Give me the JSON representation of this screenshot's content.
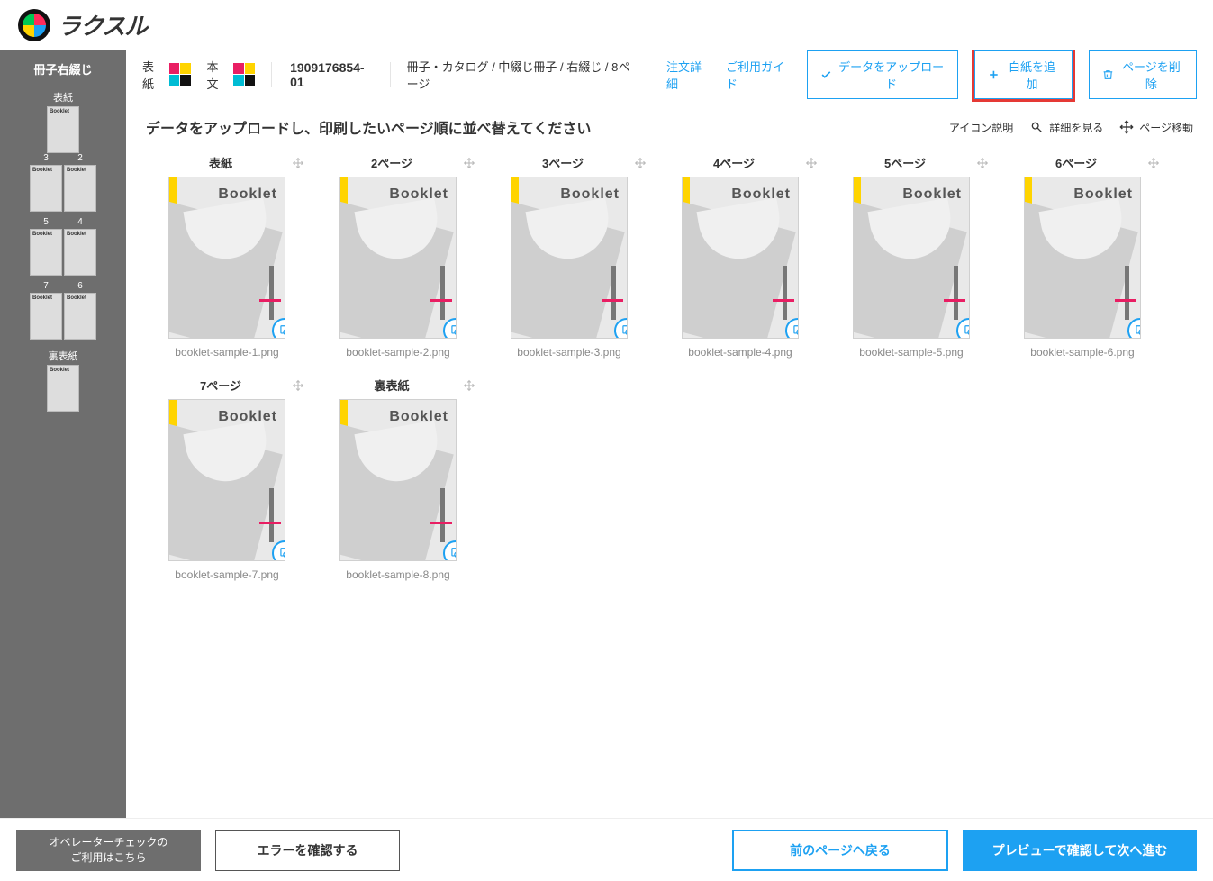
{
  "brand": "ラクスル",
  "sidebar": {
    "title": "冊子右綴じ",
    "cover_label": "表紙",
    "pairs": [
      {
        "left": "3",
        "right": "2"
      },
      {
        "left": "5",
        "right": "4"
      },
      {
        "left": "7",
        "right": "6"
      }
    ],
    "back_label": "裏表紙"
  },
  "topbar": {
    "cover_label": "表紙",
    "body_label": "本文",
    "order_id": "1909176854-01",
    "breadcrumb": "冊子・カタログ / 中綴じ冊子 / 右綴じ / 8ページ",
    "order_detail": "注文詳細",
    "guide": "ご利用ガイド",
    "upload": "データをアップロード",
    "add_blank": "白紙を追加",
    "delete_page": "ページを削除"
  },
  "instruction": "データをアップロードし、印刷したいページ順に並べ替えてください",
  "legend": {
    "icon_desc": "アイコン説明",
    "view_detail": "詳細を見る",
    "move_page": "ページ移動"
  },
  "thumb_text": "Booklet",
  "pages": [
    {
      "title": "表紙",
      "file": "booklet-sample-1.png"
    },
    {
      "title": "2ページ",
      "file": "booklet-sample-2.png"
    },
    {
      "title": "3ページ",
      "file": "booklet-sample-3.png"
    },
    {
      "title": "4ページ",
      "file": "booklet-sample-4.png"
    },
    {
      "title": "5ページ",
      "file": "booklet-sample-5.png"
    },
    {
      "title": "6ページ",
      "file": "booklet-sample-6.png"
    },
    {
      "title": "7ページ",
      "file": "booklet-sample-7.png"
    },
    {
      "title": "裏表紙",
      "file": "booklet-sample-8.png"
    }
  ],
  "footer": {
    "operator_l1": "オペレーターチェックの",
    "operator_l2": "ご利用はこちら",
    "check_errors": "エラーを確認する",
    "back": "前のページへ戻る",
    "next": "プレビューで確認して次へ進む"
  },
  "colors": {
    "accent": "#1da1f2",
    "highlight": "#e53935"
  }
}
